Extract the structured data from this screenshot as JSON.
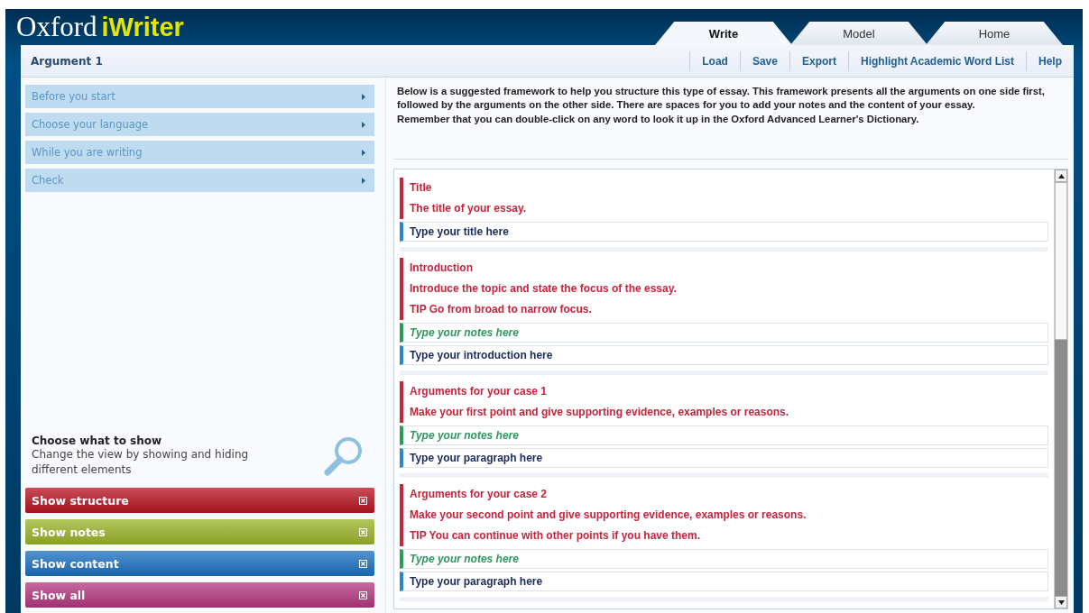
{
  "app": {
    "logo_plain": "Oxford",
    "logo_bold": "iWriter"
  },
  "tabs": [
    {
      "label": "Write",
      "selected": true
    },
    {
      "label": "Model",
      "selected": false
    },
    {
      "label": "Home",
      "selected": false
    }
  ],
  "document_title": "Argument 1",
  "toolbar": [
    "Load",
    "Save",
    "Export",
    "Highlight Academic Word List",
    "Help"
  ],
  "sidebar": {
    "items": [
      "Before you start",
      "Choose your language",
      "While you are writing",
      "Check"
    ],
    "show_panel": {
      "title": "Choose what to show",
      "description": "Change the view by showing and hiding different elements",
      "buttons": [
        {
          "label": "Show structure",
          "color": "#b5121f"
        },
        {
          "label": "Show notes",
          "color": "#99b22a"
        },
        {
          "label": "Show content",
          "color": "#1a6fbf"
        },
        {
          "label": "Show all",
          "color": "#b3367d"
        }
      ]
    }
  },
  "instructions": [
    "Below is a suggested framework to help you structure this type of essay. This framework presents all the arguments on one side first, followed by the arguments on the other side. There are spaces for you to add your notes and the content of your essay.",
    "Remember that you can double-click on any word to look it up in the Oxford Advanced Learner's Dictionary."
  ],
  "sections": [
    {
      "structure": [
        "Title",
        "The title of your essay."
      ],
      "content": {
        "placeholder": "Type your title here"
      }
    },
    {
      "structure": [
        "Introduction",
        "Introduce the topic and state the focus of the essay.",
        "TIP Go from broad to narrow focus."
      ],
      "notes": {
        "placeholder": "Type your notes here"
      },
      "content": {
        "placeholder": "Type your introduction here"
      }
    },
    {
      "structure": [
        "Arguments for your case 1",
        "Make your first point and give supporting evidence, examples or reasons."
      ],
      "notes": {
        "placeholder": "Type your notes here"
      },
      "content": {
        "placeholder": "Type your paragraph here"
      }
    },
    {
      "structure": [
        "Arguments for your case 2",
        "Make your second point and give supporting evidence, examples or reasons.",
        "TIP You can continue with other points if you have them."
      ],
      "notes": {
        "placeholder": "Type your notes here"
      },
      "content": {
        "placeholder": "Type your paragraph here"
      }
    }
  ]
}
